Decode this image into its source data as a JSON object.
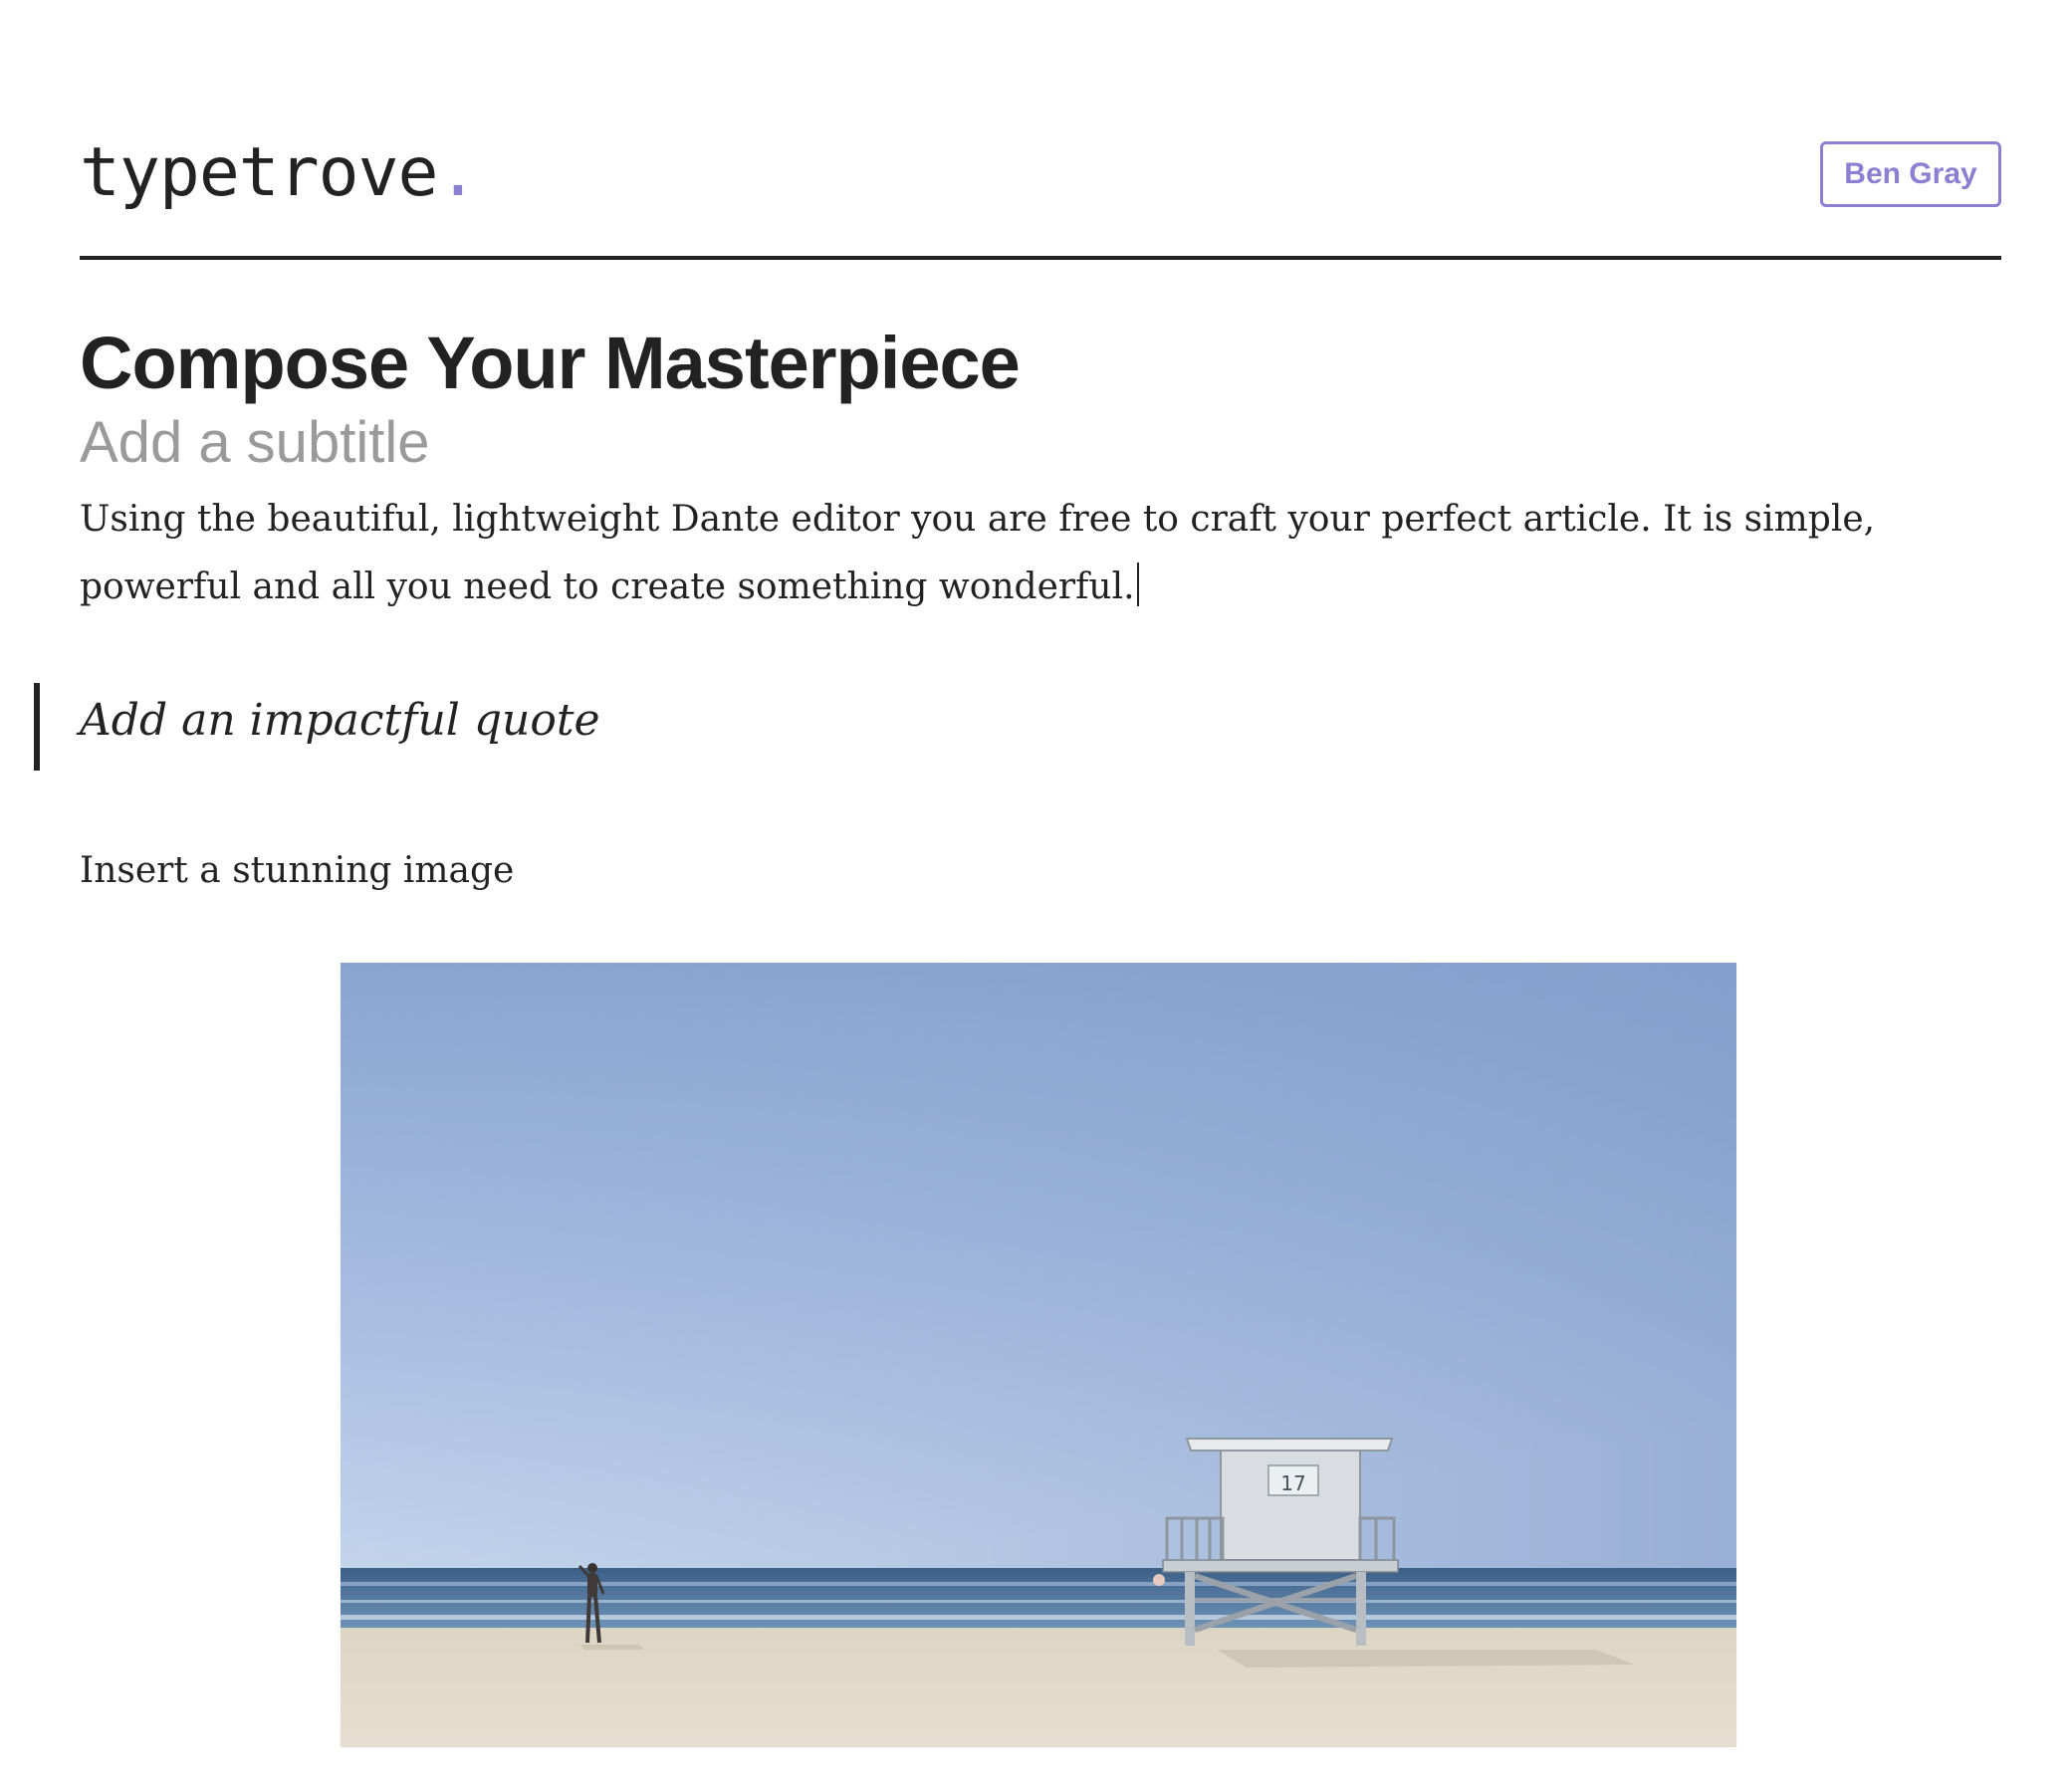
{
  "header": {
    "logo_text": "typetrove",
    "logo_dot": ".",
    "user_name": "Ben Gray"
  },
  "editor": {
    "title": "Compose Your Masterpiece",
    "subtitle_placeholder": "Add a subtitle",
    "body": "Using the beautiful, lightweight Dante editor you are free to craft your perfect article. It is simple, powerful and all you need to create something wonderful.",
    "quote": "Add an impactful quote",
    "image_prompt": "Insert a stunning image"
  },
  "image": {
    "tower_number": "17"
  },
  "colors": {
    "accent": "#8a7fd0",
    "text": "#222222",
    "placeholder": "#9a9a9a"
  }
}
